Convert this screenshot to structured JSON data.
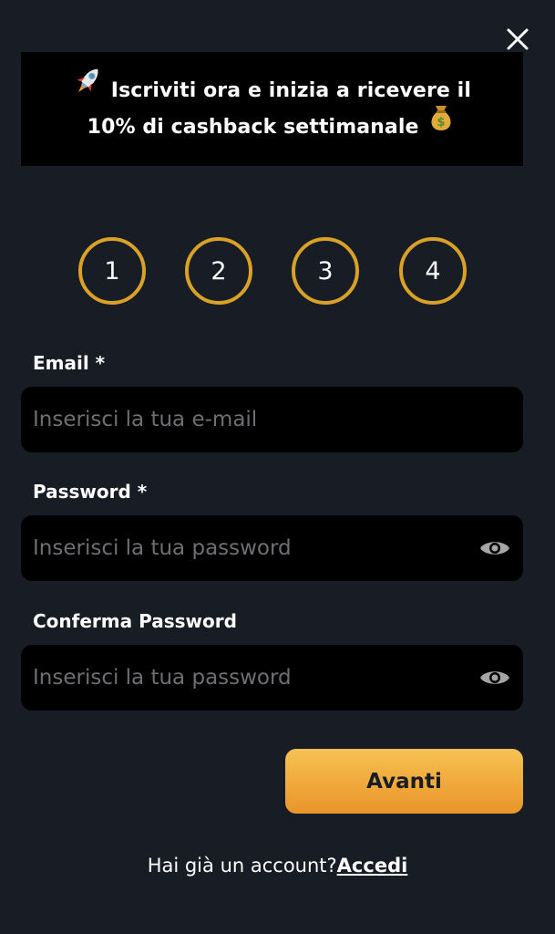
{
  "banner": {
    "line1": "Iscriviti ora e inizia a ricevere il",
    "line2": "10% di cashback settimanale",
    "icons": [
      "rocket-icon",
      "money-bag-icon"
    ]
  },
  "steps": [
    "1",
    "2",
    "3",
    "4"
  ],
  "form": {
    "email": {
      "label": "Email *",
      "placeholder": "Inserisci la tua e-mail"
    },
    "password": {
      "label": "Password *",
      "placeholder": "Inserisci la tua password"
    },
    "confirm_password": {
      "label": "Conferma Password",
      "placeholder": "Inserisci la tua password"
    }
  },
  "next_button": "Avanti",
  "login_prompt": {
    "text": "Hai già un account?",
    "link": "Accedi"
  },
  "colors": {
    "background": "#181c25",
    "panel": "#000000",
    "accent": "#d9a126",
    "button_gradient_top": "#f6c256",
    "button_gradient_bottom": "#e9962a",
    "placeholder": "#6f6f73"
  }
}
